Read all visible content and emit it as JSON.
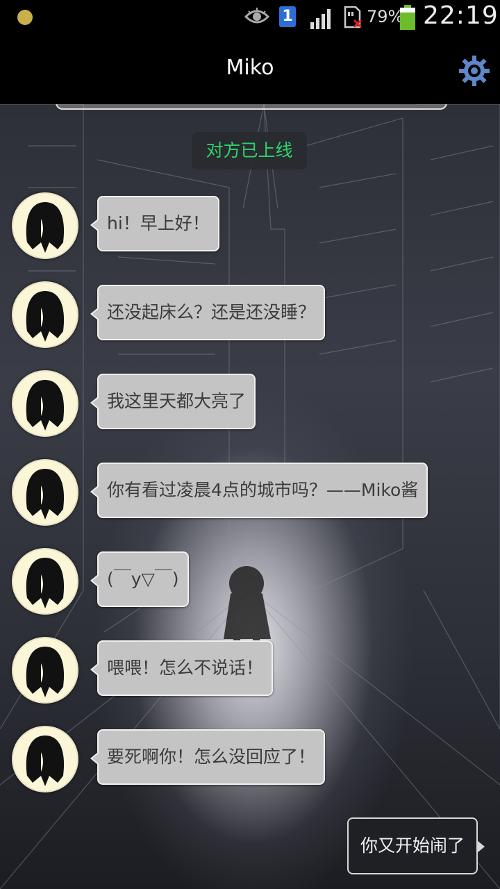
{
  "status_bar": {
    "battery": "79%",
    "time": "22:19",
    "sim_label": "1",
    "icons": [
      "notification-dot-icon",
      "eye-icon",
      "sim-1-icon",
      "signal-icon",
      "sd-card-icon",
      "battery-icon"
    ]
  },
  "header": {
    "title": "Miko",
    "settings_icon": "gear-icon"
  },
  "chat": {
    "online_notice": "对方已上线",
    "incoming": [
      {
        "text": "hi！早上好！"
      },
      {
        "text": "还没起床么？还是还没睡？"
      },
      {
        "text": "我这里天都大亮了"
      },
      {
        "text": "你有看过凌晨4点的城市吗？——Miko酱"
      },
      {
        "text": "(￣y▽￣)"
      },
      {
        "text": "喂喂！怎么不说话！"
      },
      {
        "text": "要死啊你！怎么没回应了！"
      }
    ],
    "outgoing": [
      {
        "text": "你又开始闹了"
      }
    ]
  },
  "colors": {
    "online_text": "#2fd36b",
    "incoming_bubble": "#c4c4c4",
    "outgoing_bubble": "#1f2026",
    "avatar_bg": "#fbf6d8",
    "battery": "#6cbd2a",
    "sim_badge": "#2b6fd6",
    "gear": "#5f86c8"
  }
}
